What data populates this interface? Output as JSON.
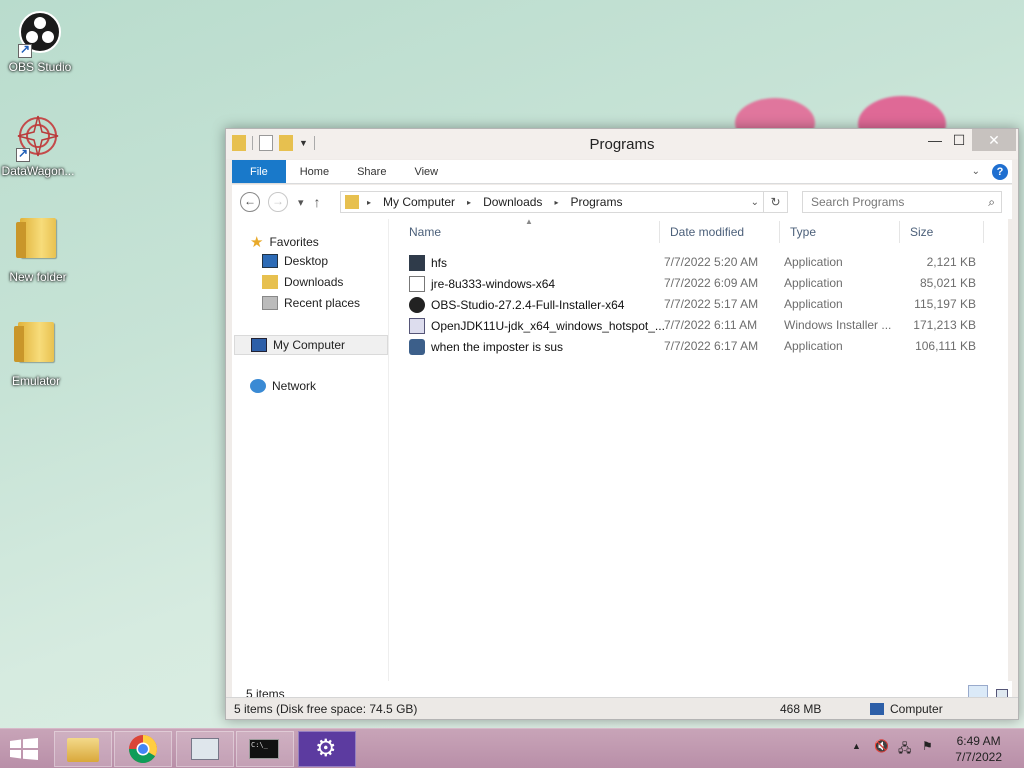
{
  "desktop": {
    "icons": [
      {
        "label": "OBS Studio",
        "icon": "obs-icon"
      },
      {
        "label": "DataWagon...",
        "icon": "datawagon-icon"
      },
      {
        "label": "New folder",
        "icon": "folder-icon"
      },
      {
        "label": "Emulator",
        "icon": "folder-icon"
      }
    ]
  },
  "window": {
    "title": "Programs",
    "ribbon_tabs": [
      "File",
      "Home",
      "Share",
      "View"
    ],
    "address": {
      "crumbs": [
        "My Computer",
        "Downloads",
        "Programs"
      ]
    },
    "search": {
      "placeholder": "Search Programs"
    },
    "nav": {
      "favorites": "Favorites",
      "favorites_items": [
        "Desktop",
        "Downloads",
        "Recent places"
      ],
      "my_computer": "My Computer",
      "network": "Network"
    },
    "columns": [
      "Name",
      "Date modified",
      "Type",
      "Size"
    ],
    "files": [
      {
        "name": "hfs",
        "date": "7/7/2022 5:20 AM",
        "type": "Application",
        "size": "2,121 KB",
        "icon": "hfs-icon"
      },
      {
        "name": "jre-8u333-windows-x64",
        "date": "7/7/2022 6:09 AM",
        "type": "Application",
        "size": "85,021 KB",
        "icon": "java-icon"
      },
      {
        "name": "OBS-Studio-27.2.4-Full-Installer-x64",
        "date": "7/7/2022 5:17 AM",
        "type": "Application",
        "size": "115,197 KB",
        "icon": "obs-icon"
      },
      {
        "name": "OpenJDK11U-jdk_x64_windows_hotspot_...",
        "date": "7/7/2022 6:11 AM",
        "type": "Windows Installer ...",
        "size": "171,213 KB",
        "icon": "installer-icon"
      },
      {
        "name": "when the imposter is sus",
        "date": "7/7/2022 6:17 AM",
        "type": "Application",
        "size": "106,111 KB",
        "icon": "app-icon"
      }
    ],
    "item_count": "5 items",
    "statusbar": {
      "left": "5 items (Disk free space: 74.5 GB)",
      "size": "468 MB",
      "location": "Computer"
    }
  },
  "taskbar": {
    "clock_time": "6:49 AM",
    "clock_date": "7/7/2022"
  },
  "colors": {
    "file_tab": "#1979ca",
    "taskbar": "#b98fa8"
  }
}
